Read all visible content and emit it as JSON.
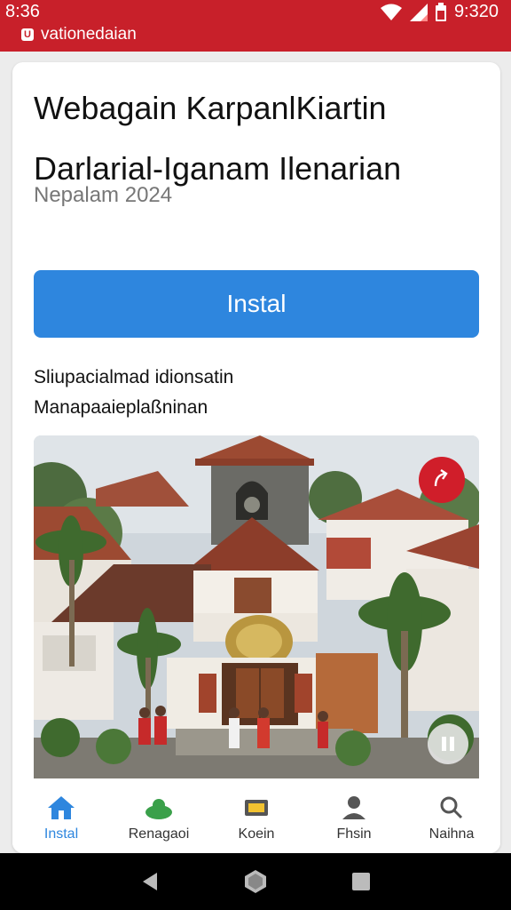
{
  "status_bar": {
    "time": "8:36",
    "clock_right": "9:320",
    "app_label": "vationedaian",
    "color": "#c8202a"
  },
  "content": {
    "title": "Webagain KarpanlKiartin Darlarial-Iganam Ilenarian",
    "subtitle": "Nepalam 2024",
    "install_label": "Instal",
    "description_line1": "Sliupacialmad idionsatin",
    "description_line2": "Manapaaieplaßninan",
    "accent": "#2e86de"
  },
  "photo": {
    "badge_icon": "share-icon",
    "corner_icon": "pause-icon"
  },
  "bottom_nav": {
    "items": [
      {
        "label": "Instal",
        "icon": "home-icon",
        "active": true
      },
      {
        "label": "Renagaoi",
        "icon": "cloud-icon",
        "active": false
      },
      {
        "label": "Koein",
        "icon": "wallet-icon",
        "active": false
      },
      {
        "label": "Fhsin",
        "icon": "person-icon",
        "active": false
      },
      {
        "label": "Naihna",
        "icon": "search-icon",
        "active": false
      }
    ]
  }
}
